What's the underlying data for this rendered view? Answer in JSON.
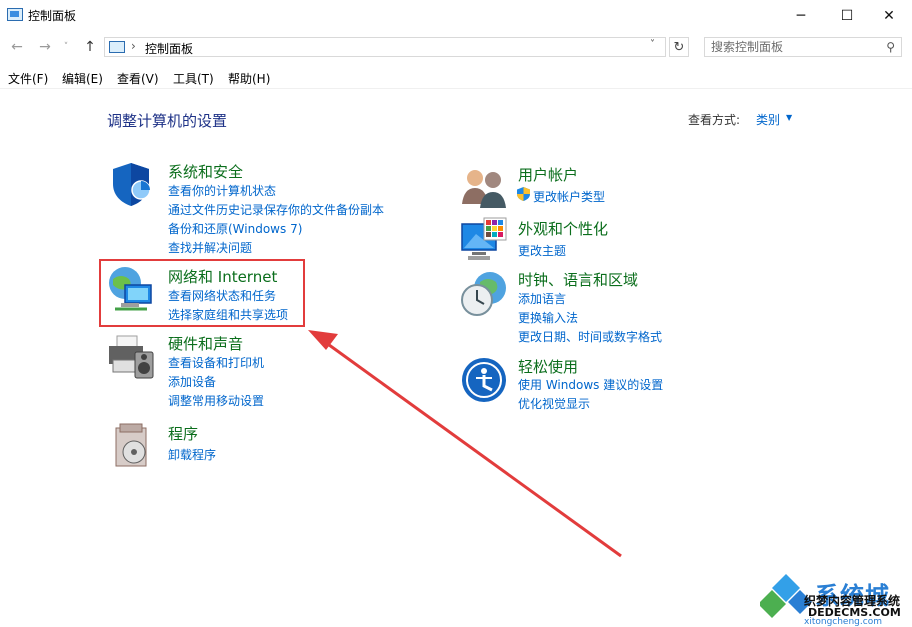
{
  "window": {
    "title": "控制面板",
    "minimize_glyph": "─",
    "maximize_glyph": "☐",
    "close_glyph": "✕"
  },
  "nav": {
    "back_glyph": "←",
    "forward_glyph": "→",
    "recent_glyph": "˅",
    "up_glyph": "↑",
    "address_separator": "›",
    "address_text": "控制面板",
    "address_dropdown_glyph": "˅",
    "refresh_glyph": "↻",
    "search_placeholder": "搜索控制面板",
    "search_icon_glyph": "⚲"
  },
  "menu": [
    "文件(F)",
    "编辑(E)",
    "查看(V)",
    "工具(T)",
    "帮助(H)"
  ],
  "page": {
    "heading": "调整计算机的设置",
    "view_by_label": "查看方式:",
    "view_by_value": "类别",
    "view_by_arrow": "▼"
  },
  "categories": [
    {
      "title": "系统和安全",
      "icon": "shield-icon",
      "links": [
        "查看你的计算机状态",
        "通过文件历史记录保存你的文件备份副本",
        "备份和还原(Windows 7)",
        "查找并解决问题"
      ]
    },
    {
      "title": "网络和 Internet",
      "icon": "network-globe-icon",
      "links": [
        "查看网络状态和任务",
        "选择家庭组和共享选项"
      ]
    },
    {
      "title": "硬件和声音",
      "icon": "printer-speaker-icon",
      "links": [
        "查看设备和打印机",
        "添加设备",
        "调整常用移动设置"
      ]
    },
    {
      "title": "程序",
      "icon": "programs-disc-icon",
      "links": [
        "卸载程序"
      ]
    },
    {
      "title": "用户帐户",
      "icon": "users-icon",
      "links": [
        "更改帐户类型"
      ]
    },
    {
      "title": "外观和个性化",
      "icon": "monitor-palette-icon",
      "links": [
        "更改主题"
      ]
    },
    {
      "title": "时钟、语言和区域",
      "icon": "clock-globe-icon",
      "links": [
        "添加语言",
        "更换输入法",
        "更改日期、时间或数字格式"
      ]
    },
    {
      "title": "轻松使用",
      "icon": "ease-of-access-icon",
      "links": [
        "使用 Windows 建议的设置",
        "优化视觉显示"
      ]
    }
  ],
  "colors": {
    "category_title": "#0b6e1c",
    "link": "#0066cc",
    "heading": "#1e3287",
    "highlight": "#e23c3c"
  },
  "watermark": {
    "brand": "系统城",
    "line1": "织梦内容管理系统",
    "line2": "DEDECMS.COM",
    "line3": "xitongcheng.com"
  }
}
